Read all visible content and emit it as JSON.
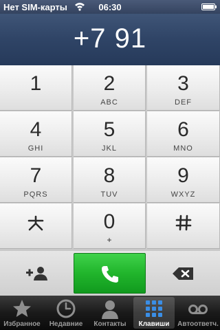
{
  "status_bar": {
    "carrier": "Нет SIM-карты",
    "time": "06:30"
  },
  "display": {
    "number": "+7 91"
  },
  "keypad": {
    "keys": [
      {
        "digit": "1",
        "letters": ""
      },
      {
        "digit": "2",
        "letters": "ABC"
      },
      {
        "digit": "3",
        "letters": "DEF"
      },
      {
        "digit": "4",
        "letters": "GHI"
      },
      {
        "digit": "5",
        "letters": "JKL"
      },
      {
        "digit": "6",
        "letters": "MNO"
      },
      {
        "digit": "7",
        "letters": "PQRS"
      },
      {
        "digit": "8",
        "letters": "TUV"
      },
      {
        "digit": "9",
        "letters": "WXYZ"
      },
      {
        "digit": "*",
        "letters": ""
      },
      {
        "digit": "0",
        "letters": "+"
      },
      {
        "digit": "#",
        "letters": ""
      }
    ]
  },
  "actions": {
    "add_contact_icon": "add-contact-icon",
    "call_icon": "phone-icon",
    "delete_icon": "backspace-icon",
    "call_color": "#21b52c"
  },
  "tabbar": {
    "tabs": [
      {
        "label": "Избранное",
        "icon": "star-icon"
      },
      {
        "label": "Недавние",
        "icon": "clock-icon"
      },
      {
        "label": "Контакты",
        "icon": "person-icon"
      },
      {
        "label": "Клавиши",
        "icon": "keypad-icon",
        "active": true
      },
      {
        "label": "Автоответч.",
        "icon": "voicemail-icon"
      }
    ]
  }
}
